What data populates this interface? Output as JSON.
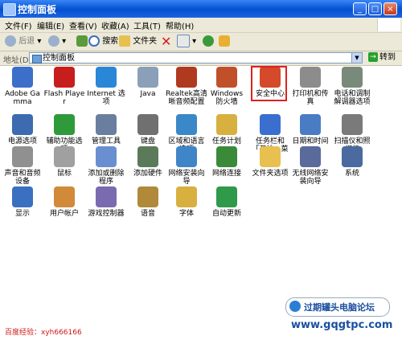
{
  "window": {
    "title": "控制面板"
  },
  "menu": [
    "文件(F)",
    "编辑(E)",
    "查看(V)",
    "收藏(A)",
    "工具(T)",
    "帮助(H)"
  ],
  "toolbar": {
    "back": "后退",
    "search": "搜索",
    "folders": "文件夹"
  },
  "address": {
    "label": "地址(D)",
    "value": "控制面板",
    "go": "转到"
  },
  "items": [
    {
      "label": "Adobe Gamma",
      "icon": "monitor-icon",
      "color": "#3b6fc9"
    },
    {
      "label": "Flash Player",
      "icon": "flash-icon",
      "color": "#c81d1d"
    },
    {
      "label": "Internet 选项",
      "icon": "globe-icon",
      "color": "#2a86d6"
    },
    {
      "label": "Java",
      "icon": "java-icon",
      "color": "#8aa0b8"
    },
    {
      "label": "Realtek高清晰音频配置",
      "icon": "speaker-icon",
      "color": "#b03a1f"
    },
    {
      "label": "Windows 防火墙",
      "icon": "firewall-icon",
      "color": "#c0502a"
    },
    {
      "label": "安全中心",
      "icon": "shield-icon",
      "color": "#d44a2a"
    },
    {
      "label": "打印机和传真",
      "icon": "printer-icon",
      "color": "#8c8c8c"
    },
    {
      "label": "电话和调制解调器选项",
      "icon": "phone-icon",
      "color": "#7a8a7a"
    },
    {
      "label": "电源选项",
      "icon": "power-icon",
      "color": "#3d6bb0"
    },
    {
      "label": "辅助功能选项",
      "icon": "accessibility-icon",
      "color": "#2f9a3a"
    },
    {
      "label": "管理工具",
      "icon": "tools-icon",
      "color": "#6a7fa0"
    },
    {
      "label": "键盘",
      "icon": "keyboard-icon",
      "color": "#707070"
    },
    {
      "label": "区域和语言选项",
      "icon": "region-icon",
      "color": "#3a88c8"
    },
    {
      "label": "任务计划",
      "icon": "scheduled-tasks-icon",
      "color": "#d8b040"
    },
    {
      "label": "任务栏和「开始」菜单",
      "icon": "taskbar-icon",
      "color": "#3a6fd0"
    },
    {
      "label": "日期和时间",
      "icon": "clock-icon",
      "color": "#4a7cc4"
    },
    {
      "label": "扫描仪和照相机",
      "icon": "scanner-icon",
      "color": "#7a7a7a"
    },
    {
      "label": "声音和音频设备",
      "icon": "sound-icon",
      "color": "#909090"
    },
    {
      "label": "鼠标",
      "icon": "mouse-icon",
      "color": "#a0a0a0"
    },
    {
      "label": "添加或删除程序",
      "icon": "add-remove-icon",
      "color": "#6a8fd0"
    },
    {
      "label": "添加硬件",
      "icon": "hardware-icon",
      "color": "#5a7a5a"
    },
    {
      "label": "网络安装向导",
      "icon": "network-setup-icon",
      "color": "#3f86c8"
    },
    {
      "label": "网络连接",
      "icon": "network-icon",
      "color": "#3a8a3a"
    },
    {
      "label": "文件夹选项",
      "icon": "folder-icon",
      "color": "#e8c050"
    },
    {
      "label": "无线网络安装向导",
      "icon": "wireless-icon",
      "color": "#5a6a9a"
    },
    {
      "label": "系统",
      "icon": "system-icon",
      "color": "#4a6aa0"
    },
    {
      "label": "显示",
      "icon": "display-icon",
      "color": "#3a70c0"
    },
    {
      "label": "用户帐户",
      "icon": "users-icon",
      "color": "#d08a3a"
    },
    {
      "label": "游戏控制器",
      "icon": "gamepad-icon",
      "color": "#7a6ab0"
    },
    {
      "label": "语音",
      "icon": "speech-icon",
      "color": "#b08a3a"
    },
    {
      "label": "字体",
      "icon": "fonts-icon",
      "color": "#d8b040"
    },
    {
      "label": "自动更新",
      "icon": "update-icon",
      "color": "#2f9a4a"
    }
  ],
  "watermark": {
    "text": "过期罐头电脑论坛",
    "site": "www.gqgtpc.com"
  },
  "credit": "百度经验：xyh666166",
  "highlight": {
    "color": "#e02020"
  }
}
